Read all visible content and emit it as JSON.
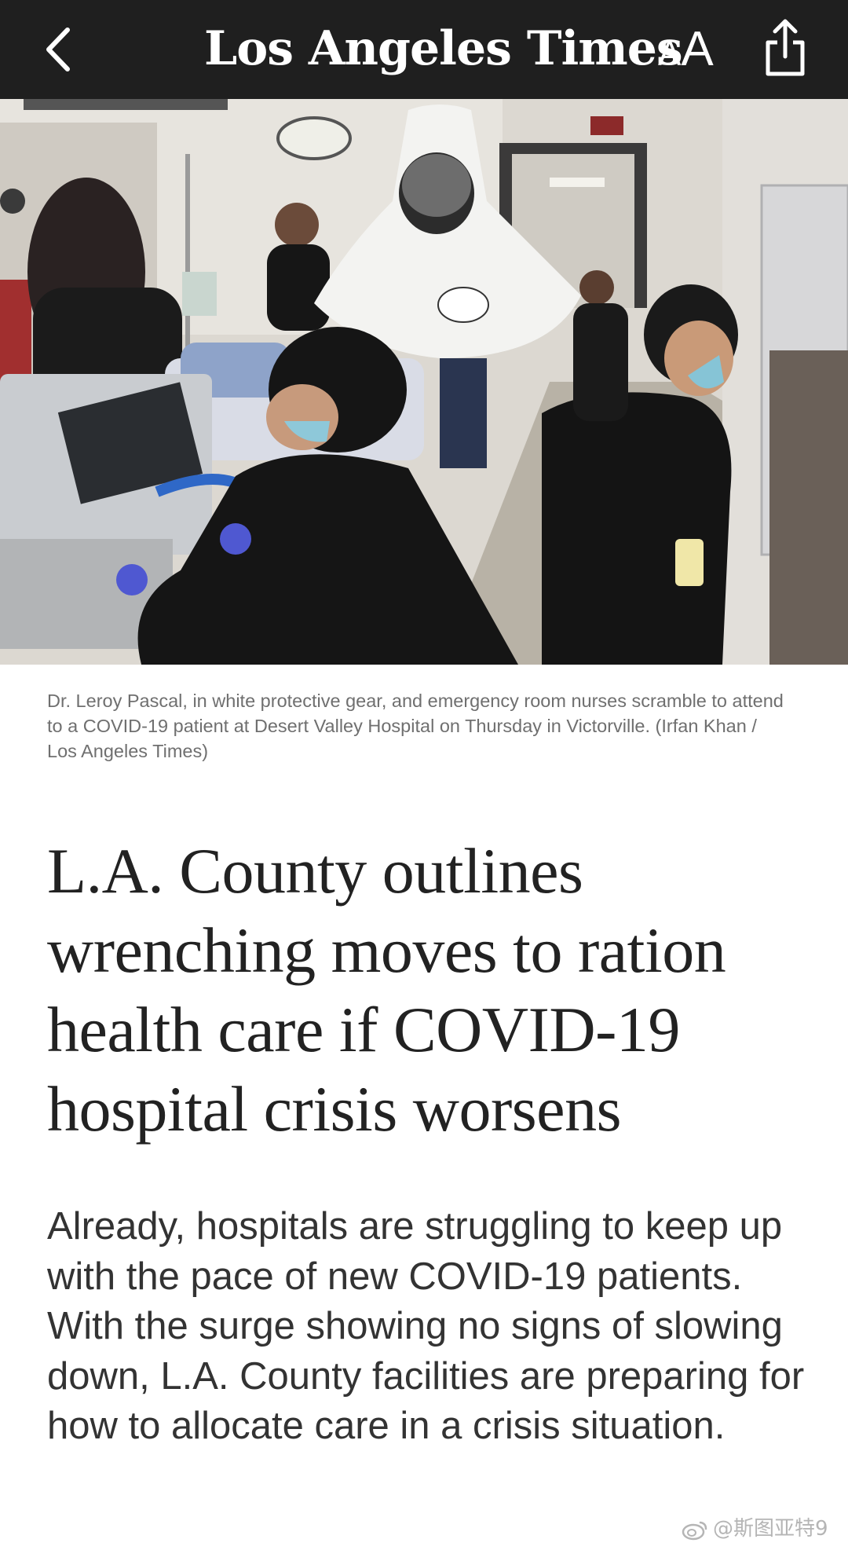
{
  "app": {
    "masthead": "Los Angeles Times",
    "text_size_small": "A",
    "text_size_large": "A"
  },
  "icons": {
    "back": "chevron-left-icon",
    "text_size": "text-size-icon",
    "share": "share-icon"
  },
  "colors": {
    "topbar_bg": "#1f1f1f",
    "headline": "#222222",
    "caption": "#6f6f6f"
  },
  "article": {
    "photo_caption": "Dr. Leroy Pascal, in white protective gear, and emergency room nurses scramble to attend to a COVID-19 patient at Desert Valley Hospital on Thursday in Victorville. (Irfan Khan / Los Angeles Times)",
    "headline": "L.A. County outlines wrenching moves to ration health care if COVID-19 hospital crisis worsens",
    "dek": "Already, hospitals are struggling to keep up with the pace of new COVID-19 patients. With the surge showing no signs of slowing down, L.A. County facilities are preparing for how to allocate care in a crisis situation."
  },
  "watermark": {
    "text": "@斯图亚特9"
  }
}
